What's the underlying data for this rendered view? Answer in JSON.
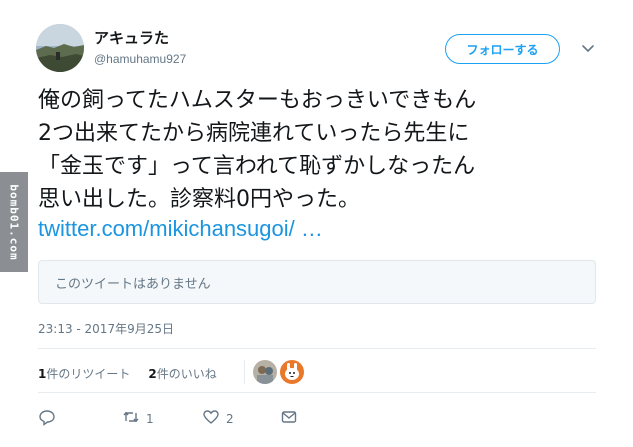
{
  "watermark": "bomb01.com",
  "user": {
    "display_name": "アキュラた",
    "handle": "@hamuhamu927"
  },
  "follow_button": "フォローする",
  "tweet": {
    "lines": [
      "俺の飼ってたハムスターもおっきいできもん",
      "2つ出来てたから病院連れていったら先生に",
      "「金玉です」って言われて恥ずかしなったん",
      "思い出した。診察料0円やった。"
    ],
    "link": "twitter.com/mikichansugoi/ …"
  },
  "quoted_tweet": "このツイートはありません",
  "timestamp": "23:13 - 2017年9月25日",
  "stats": {
    "retweet_count": "1",
    "retweet_label": "件のリツイート",
    "like_count": "2",
    "like_label": "件のいいね"
  },
  "actions": {
    "reply_icon": "reply-icon",
    "retweet_icon": "retweet-icon",
    "retweet_count": "1",
    "like_icon": "heart-icon",
    "like_count": "2",
    "dm_icon": "envelope-icon"
  },
  "colors": {
    "accent": "#1da1f2",
    "link": "#1b95e0",
    "muted": "#657786",
    "text": "#14171a"
  }
}
